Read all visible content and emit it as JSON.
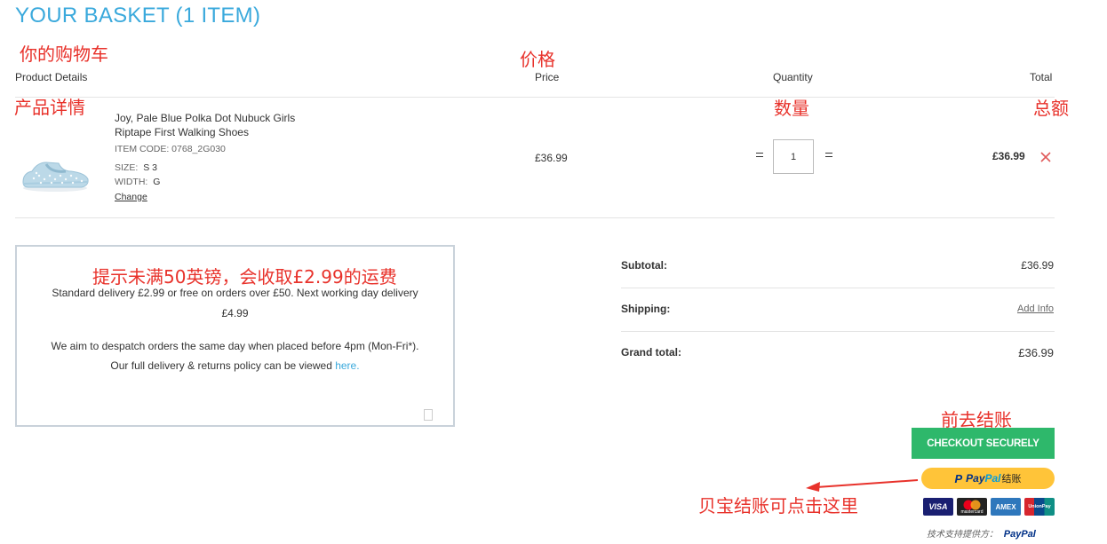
{
  "page": {
    "title": "YOUR BASKET (1 ITEM)"
  },
  "annotations": {
    "basket": "你的购物车",
    "price": "价格",
    "product_details": "产品详情",
    "quantity": "数量",
    "total": "总额",
    "shipping_tip": "提示未满50英镑，会收取£2.99的运费",
    "checkout": "前去结账",
    "paypal_tip": "贝宝结账可点击这里"
  },
  "table": {
    "headers": {
      "product": "Product Details",
      "price": "Price",
      "quantity": "Quantity",
      "total": "Total"
    }
  },
  "item": {
    "name_line1": "Joy, Pale Blue Polka Dot Nubuck Girls",
    "name_line2": "Riptape First Walking Shoes",
    "item_code": "ITEM CODE: 0768_2G030",
    "size_label": "SIZE:",
    "size_value": "S 3",
    "width_label": "WIDTH:",
    "width_value": "G",
    "change_label": "Change",
    "price": "£36.99",
    "quantity": "1",
    "total": "£36.99"
  },
  "delivery": {
    "line1": "Standard delivery £2.99 or free on orders over £50. Next working day delivery",
    "line2": "£4.99",
    "line3": "We aim to despatch orders the same day when placed before 4pm (Mon-Fri*).",
    "line4_prefix": "Our full delivery & returns policy can be viewed ",
    "line4_link": "here."
  },
  "summary": {
    "subtotal_label": "Subtotal:",
    "subtotal_value": "£36.99",
    "shipping_label": "Shipping:",
    "shipping_link": "Add Info",
    "grand_label": "Grand total:",
    "grand_value": "£36.99"
  },
  "checkout": {
    "button_label": "CHECKOUT SECURELY",
    "paypal_pay": "Pay",
    "paypal_pal": "Pal",
    "paypal_suffix": "结账",
    "powered_prefix": "技术支持提供方：",
    "powered_brand": "PayPal"
  },
  "cards": [
    "VISA",
    "mastercard",
    "AMEX",
    "UnionPay"
  ],
  "colors": {
    "accent": "#3aa9dc",
    "annotation": "#e8322b",
    "checkout": "#2eb86b",
    "paypal": "#ffc439"
  }
}
